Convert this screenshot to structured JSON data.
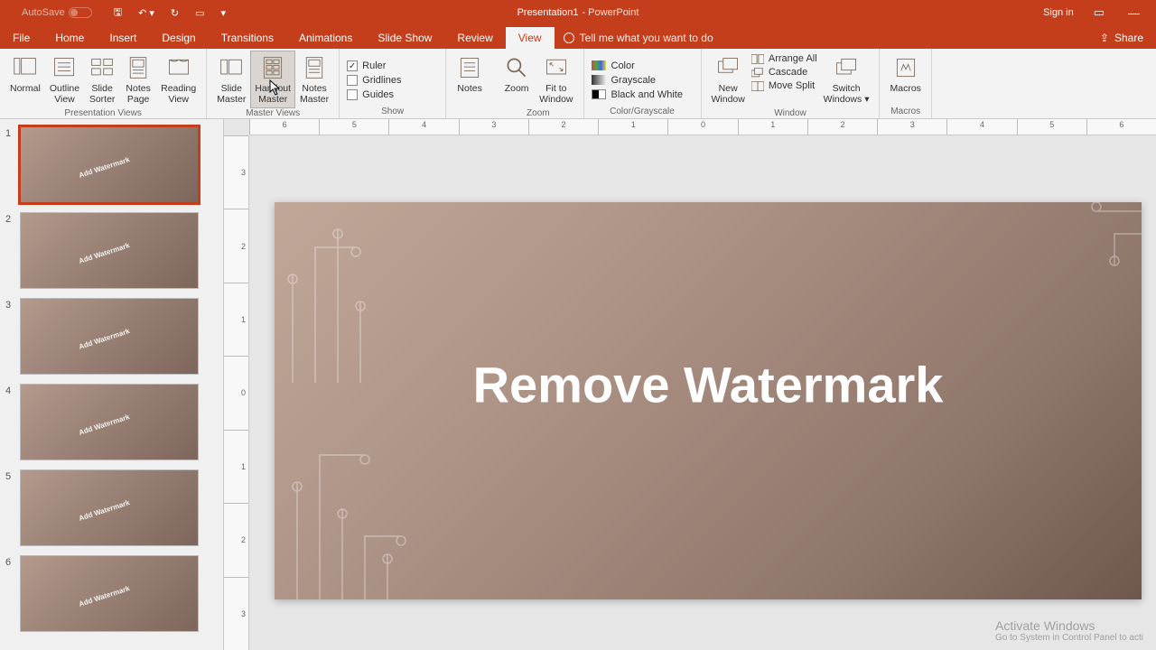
{
  "titlebar": {
    "autosave_label": "AutoSave",
    "doc_name": "Presentation1",
    "app_suffix": "- PowerPoint",
    "signin": "Sign in"
  },
  "tabs": {
    "file": "File",
    "home": "Home",
    "insert": "Insert",
    "design": "Design",
    "transitions": "Transitions",
    "animations": "Animations",
    "slideshow": "Slide Show",
    "review": "Review",
    "view": "View",
    "tellme": "Tell me what you want to do",
    "share": "Share"
  },
  "ribbon": {
    "pres_views": {
      "label": "Presentation Views",
      "normal": "Normal",
      "outline": "Outline\nView",
      "sorter": "Slide\nSorter",
      "notespage": "Notes\nPage",
      "reading": "Reading\nView"
    },
    "master_views": {
      "label": "Master Views",
      "slide_master": "Slide\nMaster",
      "handout_master": "Handout\nMaster",
      "notes_master": "Notes\nMaster"
    },
    "show": {
      "label": "Show",
      "ruler": "Ruler",
      "gridlines": "Gridlines",
      "guides": "Guides"
    },
    "notes_zoom": {
      "notes": "Notes",
      "zoom": "Zoom",
      "fit": "Fit to\nWindow",
      "zoom_label": "Zoom"
    },
    "colorgray": {
      "label": "Color/Grayscale",
      "color": "Color",
      "gray": "Grayscale",
      "bw": "Black and White"
    },
    "window": {
      "label": "Window",
      "new": "New\nWindow",
      "arrange": "Arrange All",
      "cascade": "Cascade",
      "movesplit": "Move Split",
      "switch": "Switch\nWindows"
    },
    "macros": {
      "label": "Macros",
      "btn": "Macros"
    }
  },
  "ruler_h": [
    "6",
    "5",
    "4",
    "3",
    "2",
    "1",
    "0",
    "1",
    "2",
    "3",
    "4",
    "5",
    "6"
  ],
  "ruler_v": [
    "3",
    "2",
    "1",
    "0",
    "1",
    "2",
    "3"
  ],
  "thumbs": [
    {
      "num": "1",
      "wm": "Add Watermark"
    },
    {
      "num": "2",
      "wm": "Add Watermark"
    },
    {
      "num": "3",
      "wm": "Add Watermark"
    },
    {
      "num": "4",
      "wm": "Add Watermark"
    },
    {
      "num": "5",
      "wm": "Add Watermark"
    },
    {
      "num": "6",
      "wm": "Add Watermark"
    }
  ],
  "slide": {
    "title": "Remove Watermark"
  },
  "activate": {
    "title": "Activate Windows",
    "sub": "Go to System in Control Panel to acti"
  }
}
